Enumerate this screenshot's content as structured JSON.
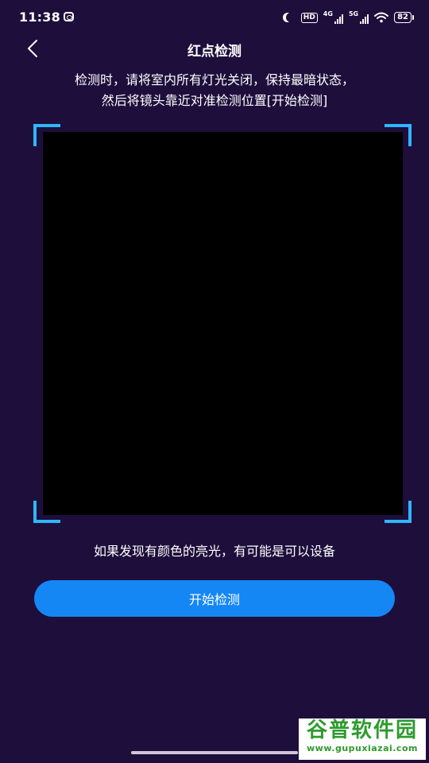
{
  "status_bar": {
    "time": "11:38",
    "hd_label": "HD",
    "network_1": "4G",
    "network_2": "5G",
    "battery": "82"
  },
  "header": {
    "title": "红点检测"
  },
  "instructions": {
    "line1": "检测时，请将室内所有灯光关闭，保持最暗状态，",
    "line2": "然后将镜头靠近对准检测位置[开始检测]"
  },
  "hint": "如果发现有颜色的亮光，有可能是可以设备",
  "start_button": {
    "label": "开始检测"
  },
  "watermark": {
    "title": "谷普软件园",
    "url": "www.gupuxiazai.com"
  },
  "colors": {
    "background": "#1e0e3b",
    "accent": "#1487f5",
    "frame_corners": "#2fb6ff",
    "camera": "#000000"
  },
  "icons": [
    "back-chevron-icon",
    "moon-icon",
    "wifi-icon",
    "signal-icon",
    "battery-icon"
  ]
}
